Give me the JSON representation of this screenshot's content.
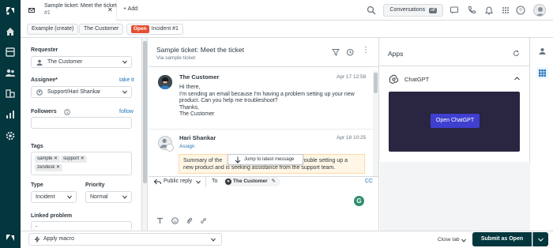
{
  "tab": {
    "title": "Sample ticket: Meet the ticket",
    "number": "#1",
    "add_label": "Add"
  },
  "topbar": {
    "conversations_label": "Conversations",
    "conversations_status": "off"
  },
  "breadcrumbs": {
    "org": "Example (create)",
    "customer": "The Customer",
    "status_badge": "Open",
    "ticket": "Incident #1"
  },
  "props": {
    "requester_label": "Requester",
    "requester_value": "The Customer",
    "assignee_label": "Assignee*",
    "take_it": "take it",
    "assignee_value": "Support/Hari Shankar",
    "followers_label": "Followers",
    "follow_link": "follow",
    "tags_label": "Tags",
    "tags": [
      "sample",
      "support",
      "zendesk"
    ],
    "type_label": "Type",
    "type_value": "Incident",
    "priority_label": "Priority",
    "priority_value": "Normal",
    "linked_label": "Linked problem",
    "linked_value": "-"
  },
  "conversation": {
    "title": "Sample ticket: Meet the ticket",
    "via": "Via sample ticket",
    "msg1": {
      "author": "The Customer",
      "date": "Apr 17 12:58",
      "lines": [
        "Hi there,",
        "I'm sending an email because I'm having a problem setting up your new",
        "product. Can you help me troubleshoot?",
        "Thanks,",
        "The Customer"
      ]
    },
    "msg2": {
      "author": "Hari Shankar",
      "date": "Apr 18 10:25",
      "assign": "Assign",
      "summary_line1_a": "Summary of the",
      "summary_line1_b": "trouble setting up a",
      "summary_line2": "new product and is seeking assistance from the support team."
    },
    "jump_label": "Jump to latest message",
    "reply_type": "Public reply",
    "to_label": "To",
    "to_value": "The Customer",
    "cc_label": "CC",
    "g_label": "G"
  },
  "apps": {
    "title": "Apps",
    "app_name": "ChatGPT",
    "open_button": "Open ChatGPT"
  },
  "bottom": {
    "apply_macro": "Apply macro",
    "close_tab": "Close tab",
    "submit": "Submit as Open"
  }
}
